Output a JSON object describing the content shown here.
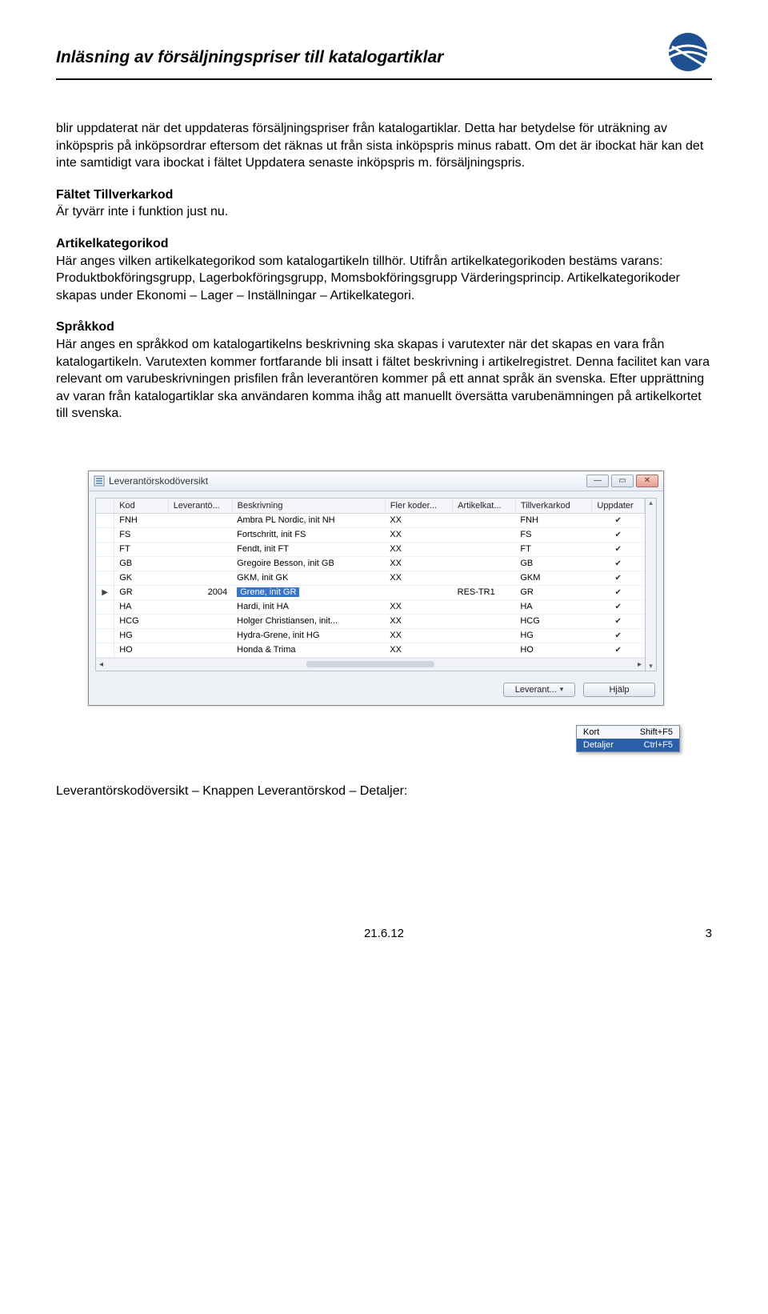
{
  "header": {
    "title": "Inläsning av försäljningspriser till katalogartiklar"
  },
  "body": {
    "p1": "blir uppdaterat när det uppdateras försäljningspriser från katalogartiklar. Detta har betydelse för uträkning av inköpspris på inköpsordrar eftersom det räknas ut från sista inköpspris minus rabatt. Om det är ibockat här kan det inte samtidigt vara ibockat i fältet Uppdatera senaste inköpspris m. försäljningspris.",
    "h_tillverkarkod": "Fältet Tillverkarkod",
    "p_tillverkarkod": "Är tyvärr inte i funktion just nu.",
    "h_artikelkat": "Artikelkategorikod",
    "p_artikelkat": "Här anges vilken artikelkategorikod som katalogartikeln tillhör. Utifrån artikelkategorikoden bestäms varans: Produktbokföringsgrupp, Lagerbokföringsgrupp, Momsbokföringsgrupp Värderingsprincip. Artikelkategorikoder skapas under Ekonomi – Lager – Inställningar – Artikelkategori.",
    "h_sprakkod": "Språkkod",
    "p_sprakkod": "Här anges en språkkod om katalogartikelns beskrivning ska skapas i varutexter när det skapas en vara från katalogartikeln. Varutexten kommer fortfarande bli insatt i fältet beskrivning i artikelregistret. Denna facilitet kan vara relevant om varubeskrivningen prisfilen från leverantören kommer på ett annat språk än svenska. Efter upprättning av varan från katalogartiklar ska användaren komma ihåg att manuellt översätta varubenämningen på artikelkortet till svenska."
  },
  "window": {
    "title": "Leverantörskodöversikt",
    "columns": [
      "Kod",
      "Leverantö...",
      "Beskrivning",
      "Fler koder...",
      "Artikelkat...",
      "Tillverkarkod",
      "Uppdater"
    ],
    "rows": [
      {
        "marker": "",
        "kod": "FNH",
        "lev": "",
        "besk": "Ambra PL Nordic, init NH",
        "fler": "XX",
        "art": "",
        "tillv": "FNH",
        "upd": true
      },
      {
        "marker": "",
        "kod": "FS",
        "lev": "",
        "besk": "Fortschritt, init FS",
        "fler": "XX",
        "art": "",
        "tillv": "FS",
        "upd": true
      },
      {
        "marker": "",
        "kod": "FT",
        "lev": "",
        "besk": "Fendt, init FT",
        "fler": "XX",
        "art": "",
        "tillv": "FT",
        "upd": true
      },
      {
        "marker": "",
        "kod": "GB",
        "lev": "",
        "besk": "Gregoire Besson, init GB",
        "fler": "XX",
        "art": "",
        "tillv": "GB",
        "upd": true
      },
      {
        "marker": "",
        "kod": "GK",
        "lev": "",
        "besk": "GKM, init GK",
        "fler": "XX",
        "art": "",
        "tillv": "GKM",
        "upd": true
      },
      {
        "marker": "▶",
        "kod": "GR",
        "lev": "2004",
        "besk": "Grene, init GR",
        "fler": "",
        "art": "RES-TR1",
        "tillv": "GR",
        "upd": true,
        "selected": true
      },
      {
        "marker": "",
        "kod": "HA",
        "lev": "",
        "besk": "Hardi, init HA",
        "fler": "XX",
        "art": "",
        "tillv": "HA",
        "upd": true
      },
      {
        "marker": "",
        "kod": "HCG",
        "lev": "",
        "besk": "Holger Christiansen, init...",
        "fler": "XX",
        "art": "",
        "tillv": "HCG",
        "upd": true
      },
      {
        "marker": "",
        "kod": "HG",
        "lev": "",
        "besk": "Hydra-Grene, init HG",
        "fler": "XX",
        "art": "",
        "tillv": "HG",
        "upd": true
      },
      {
        "marker": "",
        "kod": "HO",
        "lev": "",
        "besk": "Honda & Trima",
        "fler": "XX",
        "art": "",
        "tillv": "HO",
        "upd": true
      }
    ],
    "buttons": {
      "leverant": "Leverant...",
      "help": "Hjälp"
    },
    "menu": {
      "kort": "Kort",
      "kort_sc": "Shift+F5",
      "detaljer": "Detaljer",
      "detaljer_sc": "Ctrl+F5"
    }
  },
  "caption": "Leverantörskodöversikt – Knappen Leverantörskod – Detaljer:",
  "footer": {
    "date": "21.6.12",
    "page": "3"
  }
}
